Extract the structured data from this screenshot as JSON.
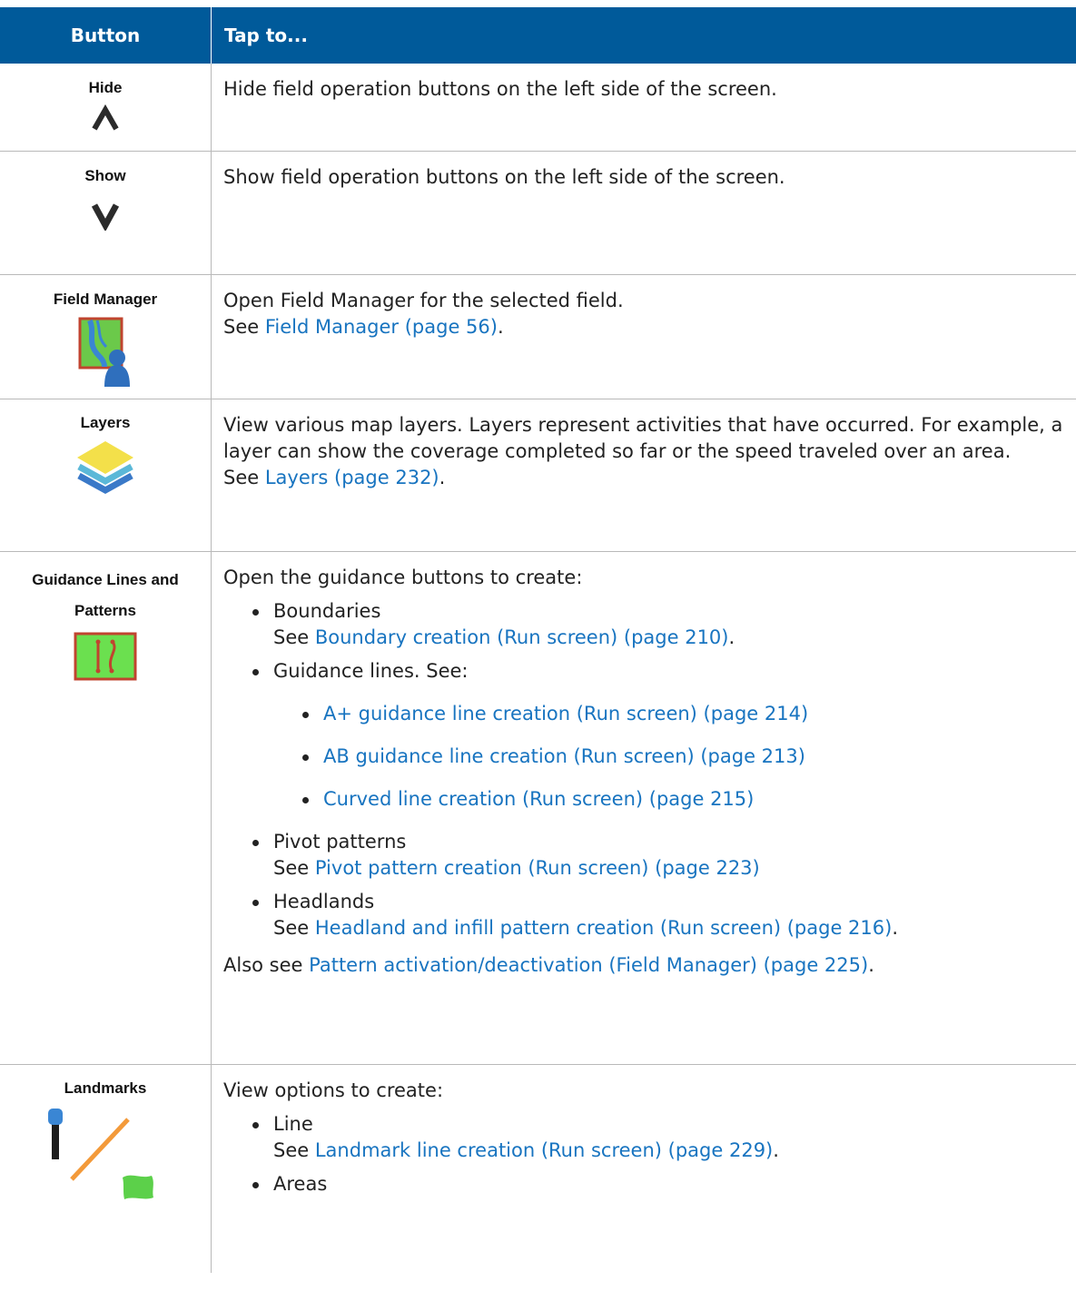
{
  "header": {
    "col1": "Button",
    "col2": "Tap to..."
  },
  "rows": {
    "hide": {
      "name": "Hide",
      "desc": "Hide field operation buttons on the left side of the screen."
    },
    "show": {
      "name": "Show",
      "desc": "Show field operation buttons on the left side of the screen."
    },
    "field_manager": {
      "name": "Field Manager",
      "desc": "Open Field Manager for the selected field.",
      "see": "See ",
      "link": "Field Manager (page 56)",
      "end": "."
    },
    "layers": {
      "name": "Layers",
      "desc": "View various map layers. Layers represent activities that have occurred. For example, a layer can show the coverage completed so far or the speed traveled over an area.",
      "see": "See ",
      "link": "Layers (page 232)",
      "end": "."
    },
    "guidance": {
      "name": "Guidance Lines and Patterns",
      "intro": "Open the guidance buttons to create:",
      "boundaries": "Boundaries",
      "boundaries_see": "See ",
      "boundaries_link": "Boundary creation (Run screen) (page 210)",
      "boundaries_end": ".",
      "guidance_lines": "Guidance lines. See:",
      "sub_links": [
        "A+ guidance line creation (Run screen) (page 214)",
        "AB guidance line creation (Run screen) (page 213)",
        "Curved line creation (Run screen) (page 215)"
      ],
      "pivot": "Pivot patterns",
      "pivot_see": "See ",
      "pivot_link": "Pivot pattern creation (Run screen) (page 223)",
      "headlands": "Headlands",
      "headlands_see": "See ",
      "headlands_link": "Headland and infill pattern creation (Run screen) (page 216)",
      "headlands_end": ".",
      "also": "Also see ",
      "also_link": "Pattern activation/deactivation (Field Manager) (page 225)",
      "also_end": "."
    },
    "landmarks": {
      "name": "Landmarks",
      "intro": "View options to create:",
      "line": "Line",
      "line_see": "See ",
      "line_link": "Landmark line creation (Run screen) (page 229)",
      "line_end": ".",
      "areas": "Areas"
    }
  },
  "colors": {
    "header_bg": "#005a9a",
    "link": "#1874c0",
    "border": "#b9b9b9"
  },
  "icons": [
    "chevron-up-icon",
    "chevron-down-icon",
    "field-manager-icon",
    "layers-icon",
    "guidance-patterns-icon",
    "landmarks-icon"
  ]
}
